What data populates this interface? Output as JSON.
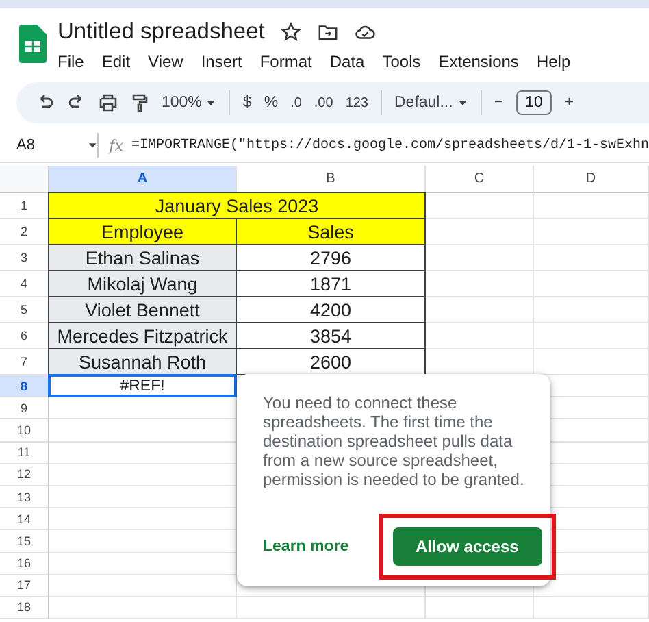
{
  "document": {
    "title": "Untitled spreadsheet"
  },
  "menu": [
    "File",
    "Edit",
    "View",
    "Insert",
    "Format",
    "Data",
    "Tools",
    "Extensions",
    "Help"
  ],
  "toolbar": {
    "zoom": "100%",
    "currency": "$",
    "percent": "%",
    "decrease_decimals": ".0",
    "increase_decimals": ".00",
    "number_format": "123",
    "font": "Defaul...",
    "font_size_decrease": "−",
    "font_size": "10",
    "font_size_increase": "+"
  },
  "formula_bar": {
    "cell_ref": "A8",
    "function_label": "fx",
    "formula": "=IMPORTRANGE(\"https://docs.google.com/spreadsheets/d/1-1-swExhn"
  },
  "grid": {
    "columns": [
      {
        "label": "A",
        "selected": true
      },
      {
        "label": "B",
        "selected": false
      },
      {
        "label": "C",
        "selected": false
      },
      {
        "label": "D",
        "selected": false
      }
    ],
    "rows": [
      {
        "number": "1",
        "selected": false,
        "cells": [
          {
            "kind": "title",
            "text": "January Sales 2023",
            "selected": false
          }
        ]
      },
      {
        "number": "2",
        "selected": false,
        "cells": [
          {
            "kind": "header",
            "text": "Employee",
            "selected": false
          },
          {
            "kind": "header",
            "text": "Sales",
            "selected": false
          }
        ]
      },
      {
        "number": "3",
        "selected": false,
        "cells": [
          {
            "kind": "name",
            "text": "Ethan Salinas",
            "selected": false
          },
          {
            "kind": "value",
            "text": "2796",
            "selected": false
          }
        ]
      },
      {
        "number": "4",
        "selected": false,
        "cells": [
          {
            "kind": "name",
            "text": "Mikolaj Wang",
            "selected": false
          },
          {
            "kind": "value",
            "text": "1871",
            "selected": false
          }
        ]
      },
      {
        "number": "5",
        "selected": false,
        "cells": [
          {
            "kind": "name",
            "text": "Violet Bennett",
            "selected": false
          },
          {
            "kind": "value",
            "text": "4200",
            "selected": false
          }
        ]
      },
      {
        "number": "6",
        "selected": false,
        "cells": [
          {
            "kind": "name",
            "text": "Mercedes Fitzpatrick",
            "selected": false
          },
          {
            "kind": "value",
            "text": "3854",
            "selected": false
          }
        ]
      },
      {
        "number": "7",
        "selected": false,
        "cells": [
          {
            "kind": "name",
            "text": "Susannah Roth",
            "selected": false
          },
          {
            "kind": "value",
            "text": "2600",
            "selected": false
          }
        ]
      },
      {
        "number": "8",
        "selected": true,
        "cells": [
          {
            "kind": "error",
            "text": "#REF!",
            "selected": true
          }
        ]
      },
      {
        "number": "9",
        "selected": false
      },
      {
        "number": "10",
        "selected": false
      },
      {
        "number": "11",
        "selected": false
      },
      {
        "number": "12",
        "selected": false
      },
      {
        "number": "13",
        "selected": false
      },
      {
        "number": "14",
        "selected": false
      },
      {
        "number": "15",
        "selected": false
      },
      {
        "number": "16",
        "selected": false
      },
      {
        "number": "17",
        "selected": false
      },
      {
        "number": "18",
        "selected": false
      }
    ]
  },
  "popup": {
    "message": "You need to connect these spreadsheets. The first time the destination spreadsheet pulls data from a new source spreadsheet, permission is needed to be granted.",
    "link": "Learn more",
    "button": "Allow access",
    "highlighted": true
  }
}
